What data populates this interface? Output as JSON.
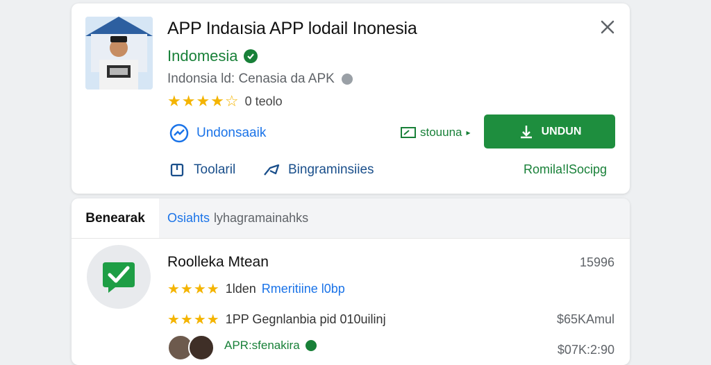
{
  "app": {
    "title": "APP Indaısia APP lodail Inonesia",
    "developer": "Indomesia",
    "meta": "Indonsia ld: Cenasia da APK",
    "rating_stars": 4.5,
    "rating_count": "0 teolo"
  },
  "actions": {
    "primary_link": "Undonsaaik",
    "secondary_link_1": "Toolaril",
    "secondary_link_2": "Bingraminsiies",
    "status_link": "stouuna",
    "download_button": "UNDUN",
    "report_link": "Romila!lSocipg"
  },
  "tabs": {
    "active": "Benearak",
    "inactive_accent": "Osiahts",
    "inactive_rest": "lyhagramainahks"
  },
  "list_item": {
    "title": "Roolleka Mtean",
    "number": "15996",
    "line1_text": "1lden",
    "line1_link": "Rmeritiine l0bp",
    "line2_text": "1PP Gegnlanbia pid 010uilinj",
    "price1": "$65KAmul",
    "developer": "APR:sfenakira",
    "price2": "$07K:2:90"
  },
  "colors": {
    "brand_green": "#1e8e3e",
    "link_blue": "#1a73e8",
    "star_gold": "#f4b400",
    "card_bg": "#ffffff",
    "page_bg": "#eef0f2"
  },
  "icons": [
    "close-icon",
    "verified-icon",
    "info-icon",
    "star-icon",
    "chart-icon",
    "download-icon",
    "share-icon",
    "arrow-icon",
    "check-icon"
  ]
}
